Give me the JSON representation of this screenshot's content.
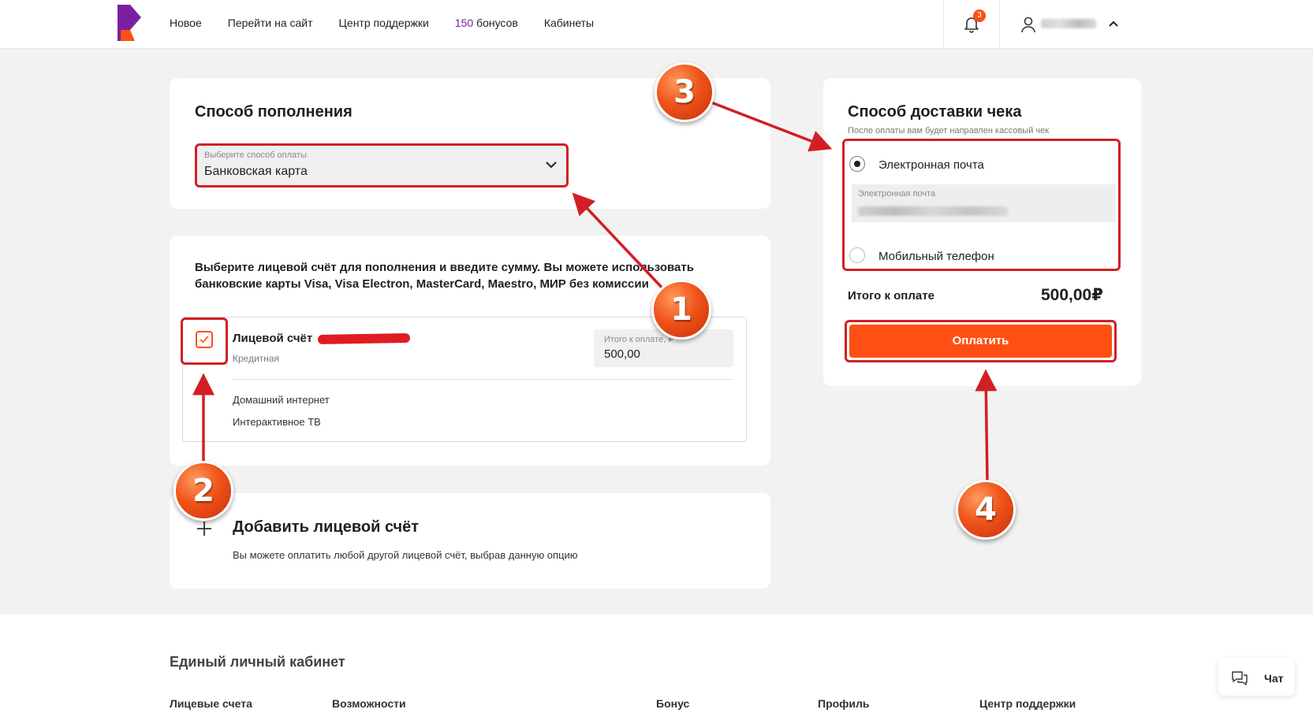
{
  "header": {
    "nav": {
      "item1": "Новое",
      "item2": "Перейти на сайт",
      "item3": "Центр поддержки",
      "bonus_count": "150",
      "bonus_word": "бонусов",
      "item5": "Кабинеты"
    },
    "notifications_count": "3"
  },
  "payment_method": {
    "title": "Способ пополнения",
    "select_placeholder": "Выберите способ оплаты",
    "select_value": "Банковская карта"
  },
  "accounts": {
    "intro": "Выберите лицевой счёт для пополнения и введите сумму. Вы можете использовать банковские карты Visa, Visa Electron, MasterCard, Maestro, МИР без комиссии",
    "account_title": "Лицевой счёт",
    "account_type": "Кредитная",
    "sum_label": "Итого к оплате, ₽",
    "sum_value": "500,00",
    "services": [
      "Домашний интернет",
      "Интерактивное ТВ"
    ]
  },
  "add_account": {
    "title": "Добавить лицевой счёт",
    "description": "Вы можете оплатить любой другой лицевой счёт, выбрав данную опцию"
  },
  "receipt": {
    "title": "Способ доставки чека",
    "subtitle": "После оплаты вам будет направлен кассовый чек",
    "option_email": "Электронная почта",
    "email_field_label": "Электронная почта",
    "option_phone": "Мобильный телефон",
    "total_label": "Итого к оплате",
    "total_value": "500,00₽",
    "pay_button": "Оплатить"
  },
  "footer": {
    "title": "Единый личный кабинет",
    "links": [
      "Лицевые счета",
      "Возможности",
      "Бонус",
      "Профиль",
      "Центр поддержки"
    ]
  },
  "chat": {
    "label": "Чат"
  },
  "annotations": {
    "step1": "1",
    "step2": "2",
    "step3": "3",
    "step4": "4"
  },
  "colors": {
    "brand_orange": "#ff4f12",
    "brand_purple": "#7a1fa2",
    "highlight_red": "#d21f25"
  }
}
